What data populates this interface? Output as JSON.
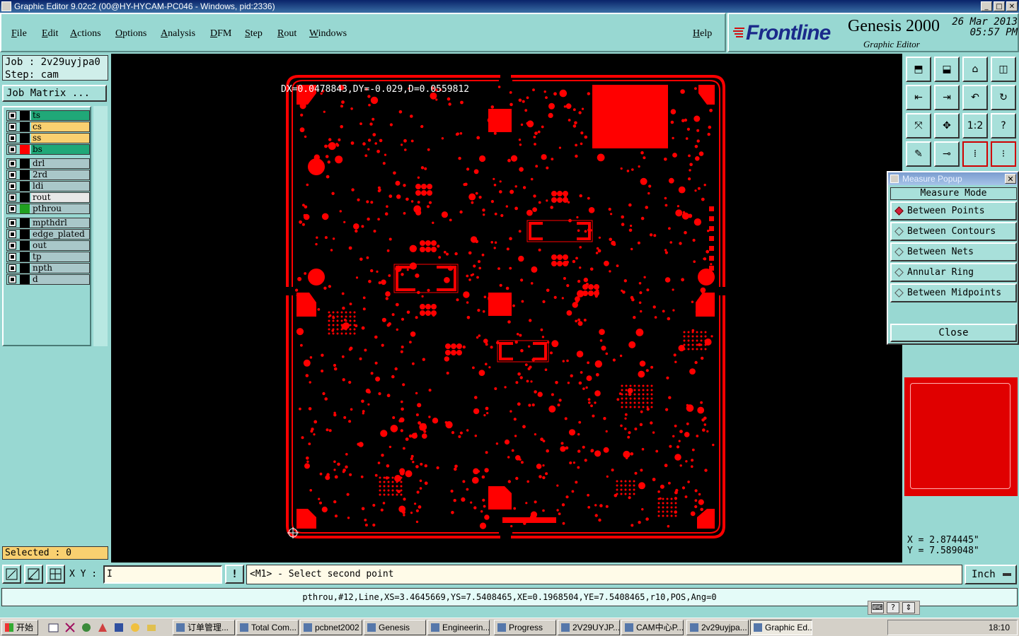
{
  "window": {
    "title": "Graphic Editor 9.02c2 (00@HY-HYCAM-PC046 - Windows, pid:2336)"
  },
  "menu": [
    "File",
    "Edit",
    "Actions",
    "Options",
    "Analysis",
    "DFM",
    "Step",
    "Rout",
    "Windows"
  ],
  "help_label": "Help",
  "brand": {
    "logo": "Frontline",
    "product": "Genesis 2000",
    "subtitle": "Graphic Editor",
    "date": "26 Mar 2013",
    "time": "05:57 PM"
  },
  "job": {
    "job": "Job : 2v29uyjpa0",
    "step": "Step: cam",
    "matrix_label": "Job Matrix ..."
  },
  "layers": [
    {
      "name": "ts",
      "color": "#20a878",
      "swatch": "#000000",
      "active": false
    },
    {
      "name": "cs",
      "color": "#f9d070",
      "swatch": "#000000",
      "active": false
    },
    {
      "name": "ss",
      "color": "#f9d070",
      "swatch": "#000000",
      "active": false
    },
    {
      "name": "bs",
      "color": "#20a878",
      "swatch": "#ff0000",
      "active": true
    },
    {
      "name": "drl",
      "color": "#a9c7c9",
      "swatch": "#000000",
      "active": false
    },
    {
      "name": "2rd",
      "color": "#a9c7c9",
      "swatch": "#000000",
      "active": false
    },
    {
      "name": "ldi",
      "color": "#a9c7c9",
      "swatch": "#000000",
      "active": false
    },
    {
      "name": "rout",
      "color": "#e8e8e8",
      "swatch": "#000000",
      "active": false
    },
    {
      "name": "pthrou",
      "color": "#a9c7c9",
      "swatch": "#20a020",
      "active": false
    },
    {
      "name": "mpthdrl",
      "color": "#a9c7c9",
      "swatch": "#000000",
      "active": false
    },
    {
      "name": "edge_plated",
      "color": "#a9c7c9",
      "swatch": "#000000",
      "active": false
    },
    {
      "name": "out",
      "color": "#a9c7c9",
      "swatch": "#000000",
      "active": false
    },
    {
      "name": "tp",
      "color": "#a9c7c9",
      "swatch": "#000000",
      "active": false
    },
    {
      "name": "npth",
      "color": "#a9c7c9",
      "swatch": "#000000",
      "active": false
    },
    {
      "name": "d",
      "color": "#a9c7c9",
      "swatch": "#000000",
      "active": false
    }
  ],
  "selected": "Selected : 0",
  "measure_readout": "DX=0.0478843,DY=-0.029,D=0.0559812",
  "popup": {
    "title": "Measure Popup",
    "mode_label": "Measure Mode",
    "options": [
      "Between Points",
      "Between Contours",
      "Between Nets",
      "Annular Ring",
      "Between Midpoints"
    ],
    "selected_index": 0,
    "close_label": "Close"
  },
  "coords": {
    "x": "X = 2.874445\"",
    "y": "Y = 7.589048\""
  },
  "command": {
    "xy_label": "X Y :",
    "xy_value": "I",
    "bang": "!",
    "prompt": "<M1> - Select second point",
    "unit": "Inch"
  },
  "status": "pthrou,#12,Line,XS=3.4645669,YS=7.5408465,XE=0.1968504,YE=7.5408465,r10,POS,Ang=0",
  "tray_icons": [
    "?"
  ],
  "taskbar": {
    "start": "开始",
    "items": [
      "订单管理...",
      "Total Com...",
      "pcbnet2002",
      "Genesis",
      "Engineerin...",
      "Progress",
      "2V29UYJP...",
      "CAM中心P...",
      "2v29uyjpa...",
      "Graphic Ed..."
    ],
    "active_index": 9,
    "clock": "18:10"
  },
  "colors": {
    "pcb": "#ff0000",
    "background": "#000000",
    "panel": "#98d8d2"
  }
}
